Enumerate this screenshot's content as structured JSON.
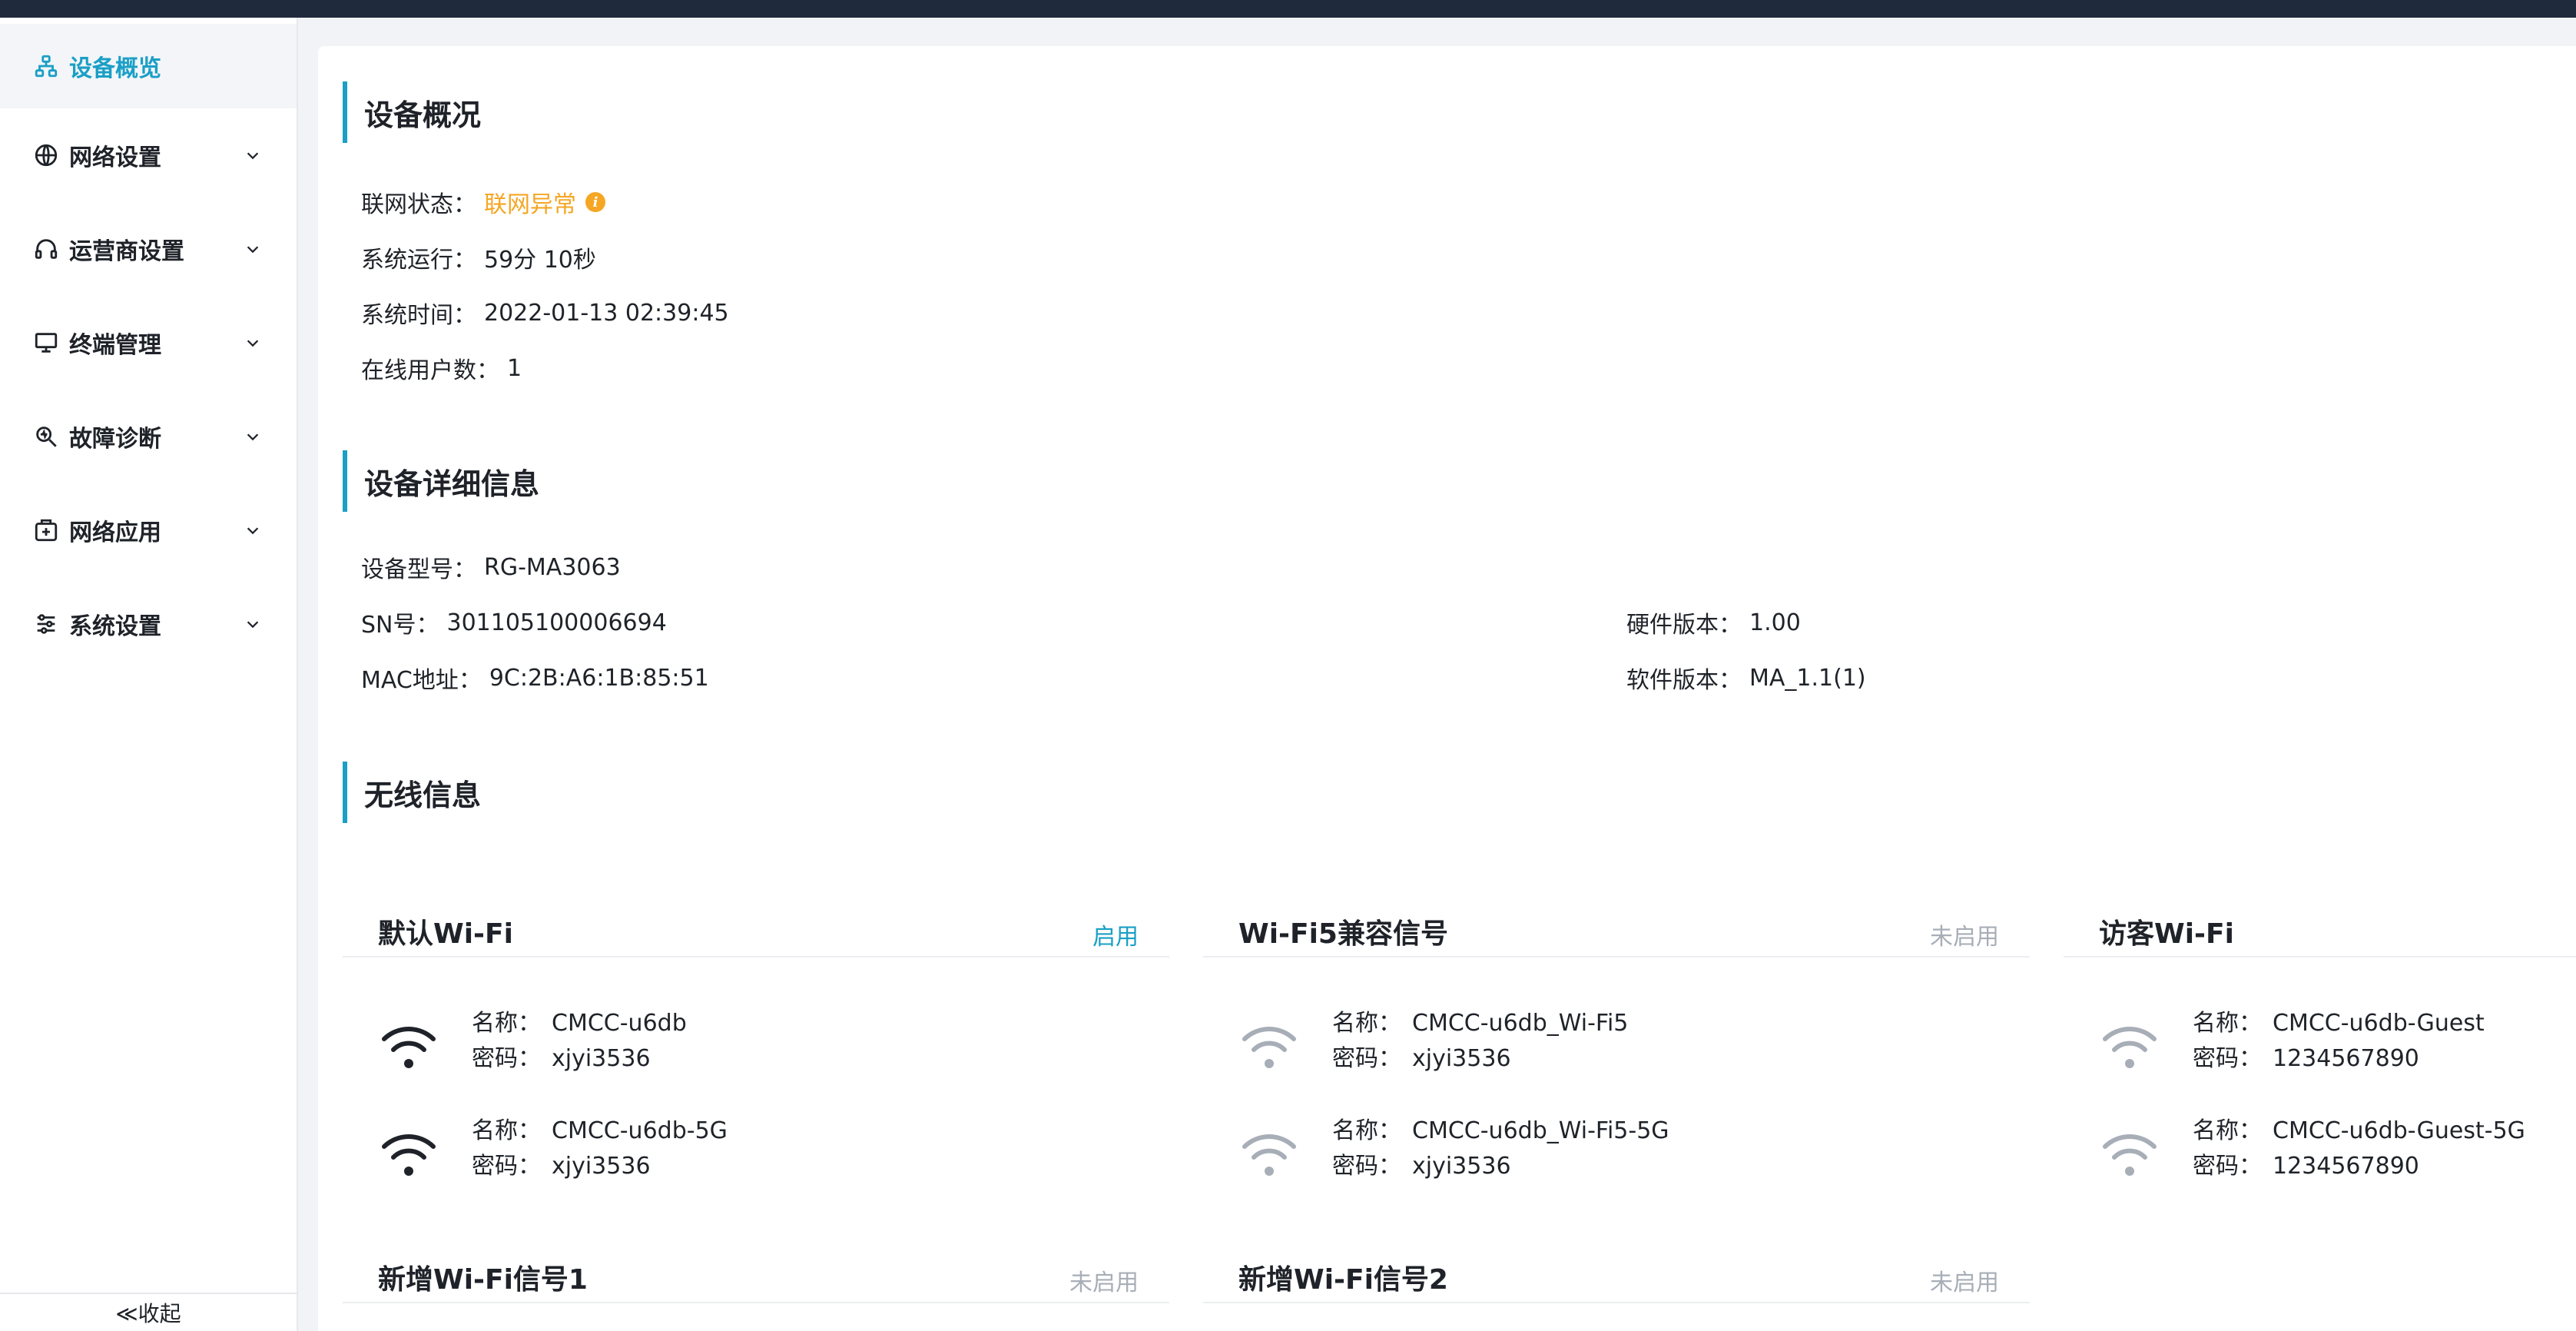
{
  "sidebar": {
    "items": [
      {
        "label": "设备概览",
        "icon": "sitemap-icon",
        "active": true
      },
      {
        "label": "网络设置",
        "icon": "globe-icon"
      },
      {
        "label": "运营商设置",
        "icon": "headset-icon"
      },
      {
        "label": "终端管理",
        "icon": "monitor-icon"
      },
      {
        "label": "故障诊断",
        "icon": "search-diagnose-icon"
      },
      {
        "label": "网络应用",
        "icon": "app-plus-icon"
      },
      {
        "label": "系统设置",
        "icon": "sliders-icon"
      }
    ],
    "collapse_label": "≪收起"
  },
  "overview": {
    "title": "设备概况",
    "net_status_label": "联网状态：",
    "net_status_value": "联网异常",
    "uptime_label": "系统运行：",
    "uptime_value": "59分 10秒",
    "time_label": "系统时间：",
    "time_value": "2022-01-13 02:39:45",
    "users_label": "在线用户数：",
    "users_value": "1"
  },
  "details": {
    "title": "设备详细信息",
    "model_label": "设备型号：",
    "model_value": "RG-MA3063",
    "sn_label": "SN号：",
    "sn_value": "301105100006694",
    "mac_label": "MAC地址：",
    "mac_value": "9C:2B:A6:1B:85:51",
    "hw_label": "硬件版本：",
    "hw_value": "1.00",
    "sw_label": "软件版本：",
    "sw_value": "MA_1.1(1)"
  },
  "wireless": {
    "title": "无线信息",
    "name_label": "名称：",
    "pwd_label": "密码：",
    "cards": [
      {
        "title": "默认Wi-Fi",
        "status": "启用",
        "enabled": true,
        "rows": [
          {
            "name": "CMCC-u6db",
            "pwd": "xjyi3536"
          },
          {
            "name": "CMCC-u6db-5G",
            "pwd": "xjyi3536"
          }
        ]
      },
      {
        "title": "Wi-Fi5兼容信号",
        "status": "未启用",
        "enabled": false,
        "rows": [
          {
            "name": "CMCC-u6db_Wi-Fi5",
            "pwd": "xjyi3536"
          },
          {
            "name": "CMCC-u6db_Wi-Fi5-5G",
            "pwd": "xjyi3536"
          }
        ]
      },
      {
        "title": "访客Wi-Fi",
        "status": "",
        "enabled": false,
        "rows": [
          {
            "name": "CMCC-u6db-Guest",
            "pwd": "1234567890"
          },
          {
            "name": "CMCC-u6db-Guest-5G",
            "pwd": "1234567890"
          }
        ]
      },
      {
        "title": "新增Wi-Fi信号1",
        "status": "未启用",
        "enabled": false,
        "rows": []
      },
      {
        "title": "新增Wi-Fi信号2",
        "status": "未启用",
        "enabled": false,
        "rows": []
      }
    ]
  },
  "colors": {
    "accent": "#1a9fc6",
    "warning": "#f5a623",
    "disabled": "#a8aeb7",
    "topbar": "#1f2a3c"
  }
}
